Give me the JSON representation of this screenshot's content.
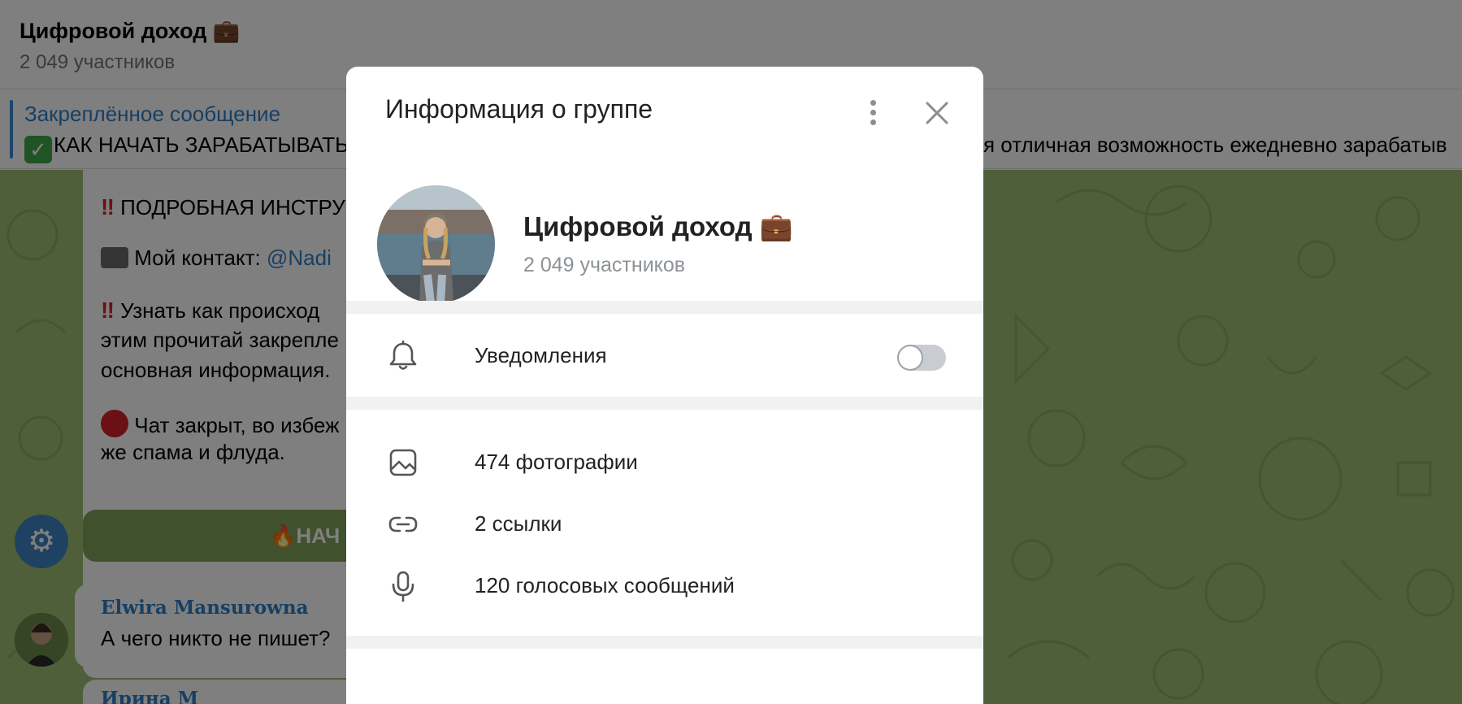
{
  "header": {
    "title": "Цифровой доход 💼",
    "members": "2 049 участников"
  },
  "pinned": {
    "title": "Закреплённое сообщение",
    "text": "КАК НАЧАТЬ ЗАРАБАТЫВАТЬ",
    "text_right": "я отличная возможность ежедневно зарабатыв"
  },
  "chat": {
    "message1_lines": [
      "ПОДРОБНАЯ ИНСТРУ",
      "Мой контакт: ",
      "@Nadi",
      "Узнать как происход",
      "этим прочитай закрепле",
      "основная информация.",
      "Чат закрыт, во избеж",
      "же спама и флуда."
    ],
    "start_button": "🔥НАЧ",
    "message2_author": "Elwira Mansurowna",
    "message2_text": "А чего никто не пишет?",
    "message3_author": "Ирина М"
  },
  "modal": {
    "title": "Информация о группе",
    "group_name": "Цифровой доход 💼",
    "members": "2 049 участников",
    "notifications_label": "Уведомления",
    "notifications_on": false,
    "media": [
      {
        "icon": "photo-icon",
        "label": "474 фотографии"
      },
      {
        "icon": "link-icon",
        "label": "2 ссылки"
      },
      {
        "icon": "microphone-icon",
        "label": "120 голосовых сообщений"
      }
    ]
  },
  "colors": {
    "accent": "#2f7fc7",
    "chat_background": "#9fbe74",
    "overlay": "rgba(0,0,0,0.5)"
  }
}
